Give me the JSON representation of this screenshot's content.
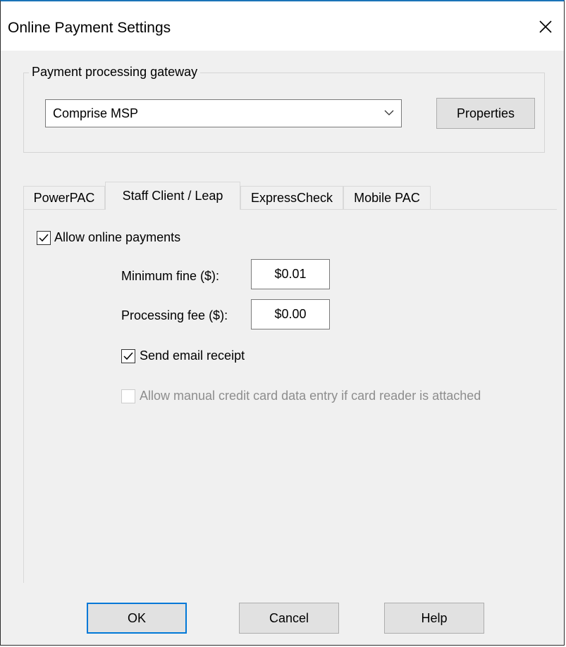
{
  "window": {
    "title": "Online Payment Settings",
    "close_icon": "close-icon"
  },
  "gateway": {
    "legend": "Payment processing gateway",
    "selected": "Comprise MSP",
    "properties_label": "Properties"
  },
  "tabs": [
    {
      "label": "PowerPAC",
      "active": false
    },
    {
      "label": "Staff Client / Leap",
      "active": true
    },
    {
      "label": "ExpressCheck",
      "active": false
    },
    {
      "label": "Mobile PAC",
      "active": false
    }
  ],
  "panel": {
    "allow_online_payments": {
      "label": "Allow online payments",
      "checked": true
    },
    "minimum_fine": {
      "label": "Minimum fine ($):",
      "value": "$0.01"
    },
    "processing_fee": {
      "label": "Processing fee ($):",
      "value": "$0.00"
    },
    "send_email_receipt": {
      "label": "Send email receipt",
      "checked": true
    },
    "manual_entry": {
      "label": "Allow manual credit card data entry if card reader is attached",
      "checked": false,
      "enabled": false
    }
  },
  "buttons": {
    "ok": "OK",
    "cancel": "Cancel",
    "help": "Help"
  },
  "colors": {
    "accent": "#0078d7",
    "window_bg": "#f0f0f0"
  }
}
